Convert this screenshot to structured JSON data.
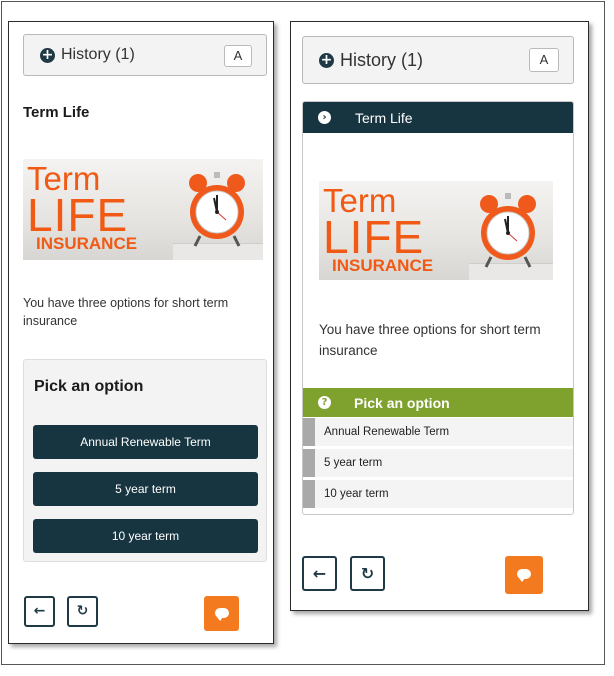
{
  "left_panel": {
    "history_label": "History (1)",
    "font_button": "A",
    "title": "Term Life",
    "banner": {
      "line1": "Term",
      "line2": "LIFE",
      "line3": "INSURANCE"
    },
    "description": "You have three options for short term insurance",
    "pick_title": "Pick an option",
    "options": [
      "Annual Renewable Term",
      "5 year term",
      "10 year term"
    ],
    "back_icon": "arrow-left-icon",
    "refresh_icon": "refresh-icon",
    "chat_icon": "chat-bubble-icon"
  },
  "right_panel": {
    "history_label": "History (1)",
    "font_button": "A",
    "card_title": "Term Life",
    "banner": {
      "line1": "Term",
      "line2": "LIFE",
      "line3": "INSURANCE"
    },
    "description": "You have three options for short term insurance",
    "pick_title": "Pick an option",
    "options": [
      "Annual Renewable Term",
      "5 year term",
      "10 year term"
    ],
    "back_icon": "arrow-left-icon",
    "refresh_icon": "refresh-icon",
    "chat_icon": "chat-bubble-icon"
  },
  "colors": {
    "dark_teal": "#173540",
    "accent_green": "#7fa12e",
    "accent_orange": "#f47a20",
    "banner_orange": "#f05a14"
  }
}
